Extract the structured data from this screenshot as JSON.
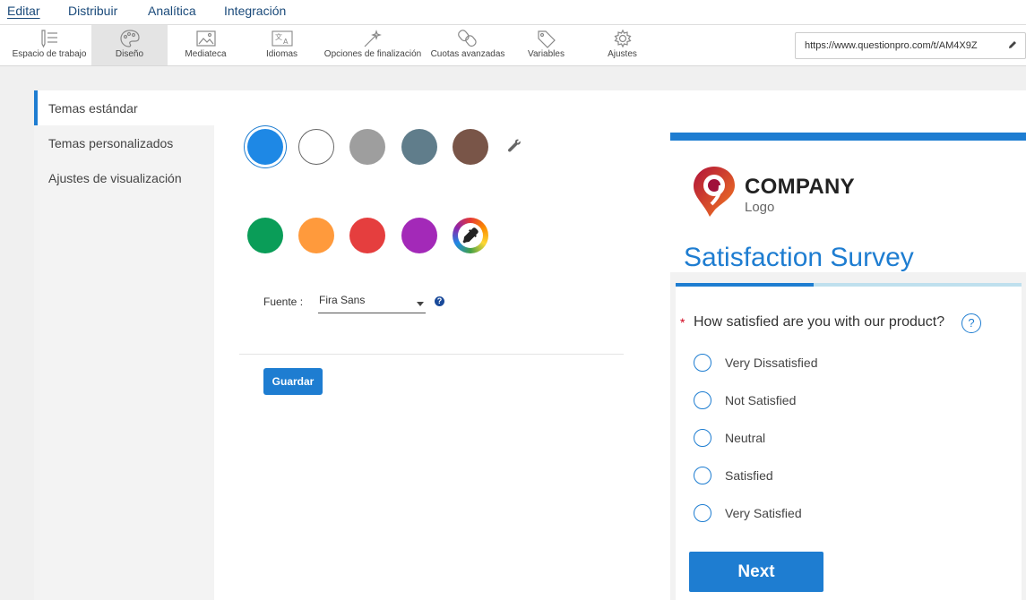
{
  "nav": {
    "tabs": [
      {
        "label": "Editar",
        "active": true
      },
      {
        "label": "Distribuir"
      },
      {
        "label": "Analítica"
      },
      {
        "label": "Integración"
      }
    ]
  },
  "toolbar": {
    "items": [
      {
        "label": "Espacio de trabajo",
        "icon": "workspace-icon"
      },
      {
        "label": "Diseño",
        "icon": "palette-icon",
        "active": true
      },
      {
        "label": "Mediateca",
        "icon": "image-icon"
      },
      {
        "label": "Idiomas",
        "icon": "translate-icon"
      },
      {
        "label": "Opciones de finalización",
        "icon": "magic-wand-icon"
      },
      {
        "label": "Cuotas avanzadas",
        "icon": "link-icon"
      },
      {
        "label": "Variables",
        "icon": "tag-icon"
      },
      {
        "label": "Ajustes",
        "icon": "gear-icon"
      }
    ],
    "url": "https://www.questionpro.com/t/AM4X9Z"
  },
  "sidebar": {
    "items": [
      {
        "label": "Temas estándar",
        "active": true
      },
      {
        "label": "Temas personalizados"
      },
      {
        "label": "Ajustes de visualización"
      }
    ]
  },
  "themes": {
    "colors": [
      "#1e88e5",
      "#ffffff",
      "#9e9e9e",
      "#607d8b",
      "#795548",
      "#0a9d58",
      "#ff9a3c",
      "#e53e3e",
      "#a329b8"
    ],
    "selected_index": 0
  },
  "font": {
    "label": "Fuente :",
    "value": "Fira Sans",
    "help": "?"
  },
  "save_label": "Guardar",
  "preview": {
    "logo_company": "COMPANY",
    "logo_sub": "Logo",
    "title": "Satisfaction Survey",
    "progress": 0.4,
    "required_mark": "*",
    "question": "How satisfied are you with our product?",
    "question_help": "?",
    "options": [
      "Very Dissatisfied",
      "Not Satisfied",
      "Neutral",
      "Satisfied",
      "Very Satisfied"
    ],
    "next_label": "Next"
  },
  "colors": {
    "accent": "#1e7dd1",
    "nav_text": "#1a4a7a"
  }
}
